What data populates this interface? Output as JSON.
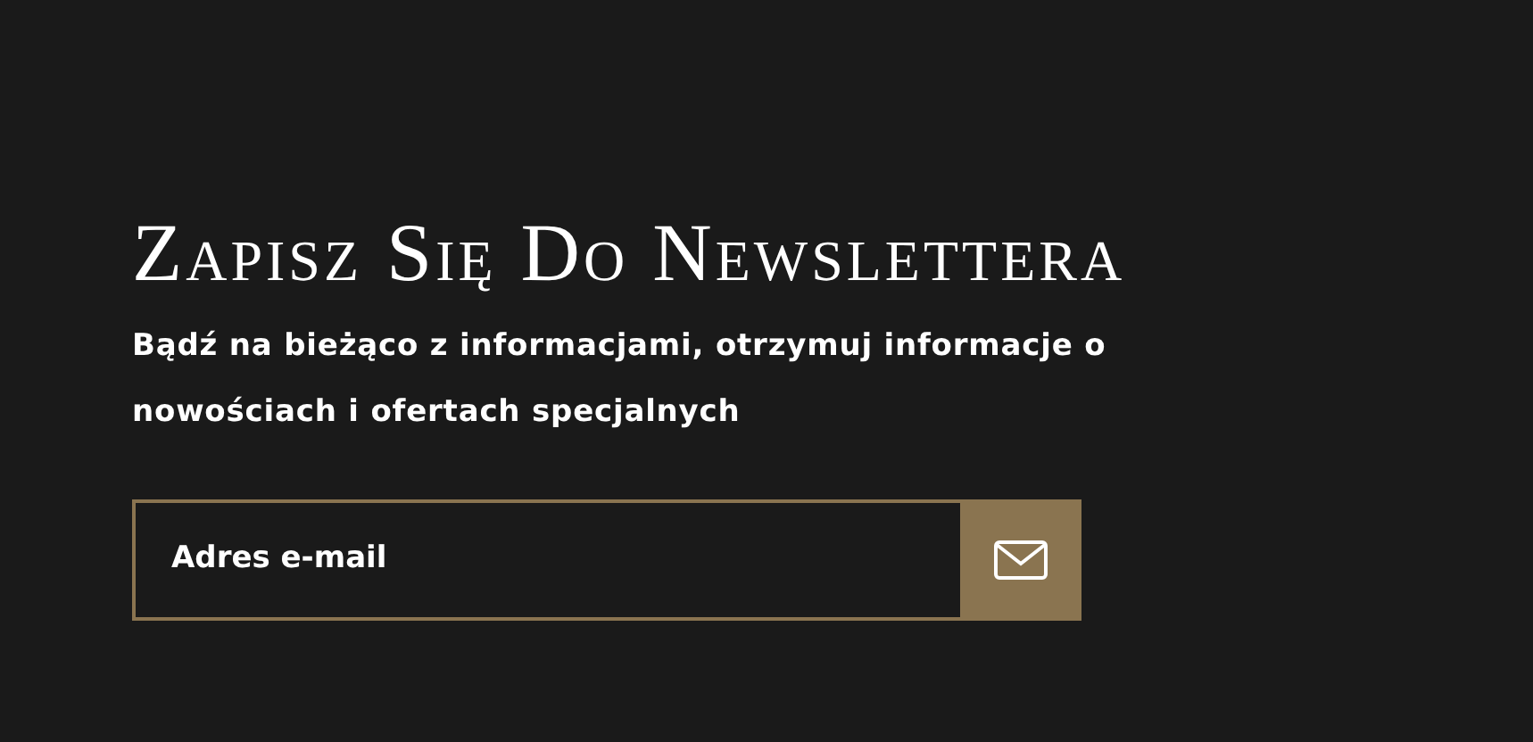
{
  "newsletter": {
    "title": "Zapisz Się Do Newslettera",
    "description": "Bądź na bieżąco z informacjami, otrzymuj informacje o nowościach i ofertach specjalnych",
    "email_field": {
      "placeholder": "Adres e-mail"
    }
  }
}
